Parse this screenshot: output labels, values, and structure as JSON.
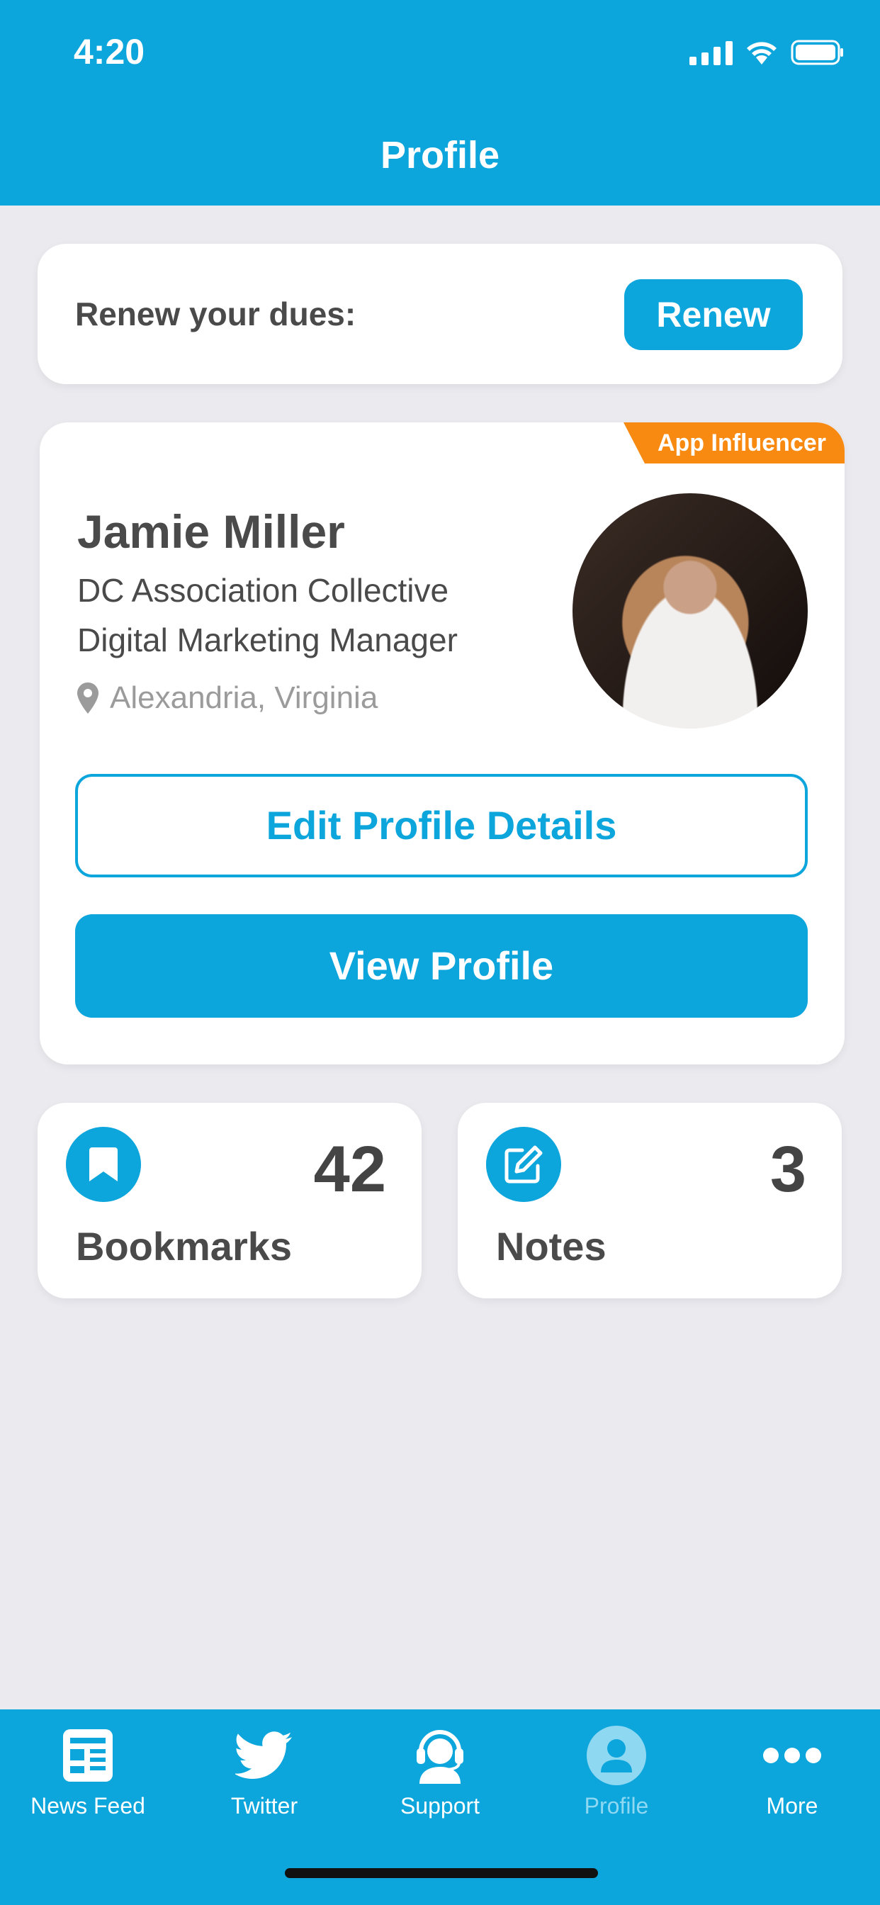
{
  "status_bar": {
    "time": "4:20"
  },
  "header": {
    "title": "Profile"
  },
  "renew": {
    "label": "Renew your dues:",
    "button": "Renew"
  },
  "profile": {
    "badge": "App Influencer",
    "name": "Jamie Miller",
    "organization": "DC Association Collective",
    "job_title": "Digital Marketing Manager",
    "location": "Alexandria, Virginia",
    "edit_button": "Edit Profile Details",
    "view_button": "View Profile"
  },
  "stats": {
    "bookmarks": {
      "count": "42",
      "label": "Bookmarks",
      "icon": "bookmark-icon"
    },
    "notes": {
      "count": "3",
      "label": "Notes",
      "icon": "edit-note-icon"
    }
  },
  "tab_bar": {
    "items": [
      {
        "label": "News Feed",
        "icon": "newspaper-icon"
      },
      {
        "label": "Twitter",
        "icon": "twitter-bird-icon"
      },
      {
        "label": "Support",
        "icon": "headset-icon"
      },
      {
        "label": "Profile",
        "icon": "user-icon",
        "active": true
      },
      {
        "label": "More",
        "icon": "more-dots-icon"
      }
    ]
  },
  "colors": {
    "primary": "#0CA5DC",
    "badge": "#F88A12",
    "background": "#EAEAEF",
    "active_tab": "#8FD8F2"
  }
}
